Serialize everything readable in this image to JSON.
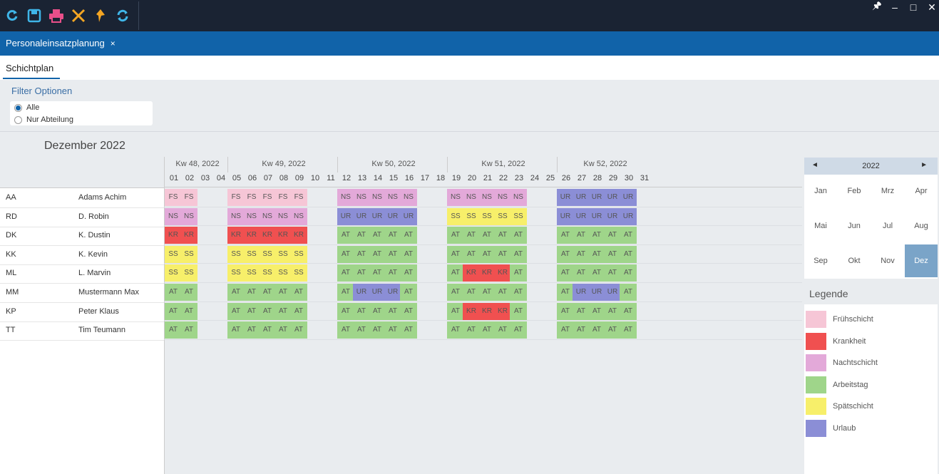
{
  "toolbar": {
    "icons": [
      "refresh-icon",
      "save-icon",
      "print-icon",
      "tools-icon",
      "pin-tool-icon",
      "sync-icon"
    ],
    "colors": {
      "refresh": "#3fb5e8",
      "save": "#3fb5e8",
      "print": "#e94f8a",
      "tools": "#f5a623",
      "pin": "#f5a623",
      "sync": "#3fb5e8"
    }
  },
  "window": {
    "pin": "📌",
    "minimize": "–",
    "maximize": "□",
    "close": "✕"
  },
  "doc_tab": {
    "label": "Personaleinsatzplanung",
    "close": "×"
  },
  "sub_tab": {
    "label": "Schichtplan"
  },
  "filter": {
    "title": "Filter Optionen",
    "options": [
      {
        "label": "Alle",
        "selected": true
      },
      {
        "label": "Nur Abteilung",
        "selected": false
      }
    ]
  },
  "month_title": "Dezember 2022",
  "weeks": [
    {
      "label": "Kw 48, 2022",
      "days": [
        "01",
        "02",
        "03",
        "04"
      ]
    },
    {
      "label": "Kw 49, 2022",
      "days": [
        "05",
        "06",
        "07",
        "08",
        "09",
        "10",
        "11"
      ]
    },
    {
      "label": "Kw 50, 2022",
      "days": [
        "12",
        "13",
        "14",
        "15",
        "16",
        "17",
        "18"
      ]
    },
    {
      "label": "Kw 51, 2022",
      "days": [
        "19",
        "20",
        "21",
        "22",
        "23",
        "24",
        "25"
      ]
    },
    {
      "label": "Kw 52, 2022",
      "days": [
        "26",
        "27",
        "28",
        "29",
        "30",
        "31"
      ]
    }
  ],
  "shift_colors": {
    "FS": "#f6c6d6",
    "KR": "#f05050",
    "NS": "#e3a9d9",
    "AT": "#9fd58a",
    "SS": "#f7ef6a",
    "UR": "#8b8ed6"
  },
  "employees": [
    {
      "abbr": "AA",
      "name": "Adams Achim",
      "shifts": [
        "FS",
        "FS",
        "",
        "",
        "FS",
        "FS",
        "FS",
        "FS",
        "FS",
        "",
        "",
        "NS",
        "NS",
        "NS",
        "NS",
        "NS",
        "",
        "",
        "NS",
        "NS",
        "NS",
        "NS",
        "NS",
        "",
        "",
        "UR",
        "UR",
        "UR",
        "UR",
        "UR",
        ""
      ]
    },
    {
      "abbr": "RD",
      "name": "D. Robin",
      "shifts": [
        "NS",
        "NS",
        "",
        "",
        "NS",
        "NS",
        "NS",
        "NS",
        "NS",
        "",
        "",
        "UR",
        "UR",
        "UR",
        "UR",
        "UR",
        "",
        "",
        "SS",
        "SS",
        "SS",
        "SS",
        "SS",
        "",
        "",
        "UR",
        "UR",
        "UR",
        "UR",
        "UR",
        ""
      ]
    },
    {
      "abbr": "DK",
      "name": "K. Dustin",
      "shifts": [
        "KR",
        "KR",
        "",
        "",
        "KR",
        "KR",
        "KR",
        "KR",
        "KR",
        "",
        "",
        "AT",
        "AT",
        "AT",
        "AT",
        "AT",
        "",
        "",
        "AT",
        "AT",
        "AT",
        "AT",
        "AT",
        "",
        "",
        "AT",
        "AT",
        "AT",
        "AT",
        "AT",
        ""
      ]
    },
    {
      "abbr": "KK",
      "name": "K. Kevin",
      "shifts": [
        "SS",
        "SS",
        "",
        "",
        "SS",
        "SS",
        "SS",
        "SS",
        "SS",
        "",
        "",
        "AT",
        "AT",
        "AT",
        "AT",
        "AT",
        "",
        "",
        "AT",
        "AT",
        "AT",
        "AT",
        "AT",
        "",
        "",
        "AT",
        "AT",
        "AT",
        "AT",
        "AT",
        ""
      ]
    },
    {
      "abbr": "ML",
      "name": "L. Marvin",
      "shifts": [
        "SS",
        "SS",
        "",
        "",
        "SS",
        "SS",
        "SS",
        "SS",
        "SS",
        "",
        "",
        "AT",
        "AT",
        "AT",
        "AT",
        "AT",
        "",
        "",
        "AT",
        "KR",
        "KR",
        "KR",
        "AT",
        "",
        "",
        "AT",
        "AT",
        "AT",
        "AT",
        "AT",
        ""
      ]
    },
    {
      "abbr": "MM",
      "name": "Mustermann Max",
      "shifts": [
        "AT",
        "AT",
        "",
        "",
        "AT",
        "AT",
        "AT",
        "AT",
        "AT",
        "",
        "",
        "AT",
        "UR",
        "UR",
        "UR",
        "AT",
        "",
        "",
        "AT",
        "AT",
        "AT",
        "AT",
        "AT",
        "",
        "",
        "AT",
        "UR",
        "UR",
        "UR",
        "AT",
        ""
      ]
    },
    {
      "abbr": "KP",
      "name": "Peter Klaus",
      "shifts": [
        "AT",
        "AT",
        "",
        "",
        "AT",
        "AT",
        "AT",
        "AT",
        "AT",
        "",
        "",
        "AT",
        "AT",
        "AT",
        "AT",
        "AT",
        "",
        "",
        "AT",
        "KR",
        "KR",
        "KR",
        "AT",
        "",
        "",
        "AT",
        "AT",
        "AT",
        "AT",
        "AT",
        ""
      ]
    },
    {
      "abbr": "TT",
      "name": "Tim Teumann",
      "shifts": [
        "AT",
        "AT",
        "",
        "",
        "AT",
        "AT",
        "AT",
        "AT",
        "AT",
        "",
        "",
        "AT",
        "AT",
        "AT",
        "AT",
        "AT",
        "",
        "",
        "AT",
        "AT",
        "AT",
        "AT",
        "AT",
        "",
        "",
        "AT",
        "AT",
        "AT",
        "AT",
        "AT",
        ""
      ]
    }
  ],
  "calendar": {
    "year": "2022",
    "prev": "◄",
    "next": "►",
    "months": [
      "Jan",
      "Feb",
      "Mrz",
      "Apr",
      "Mai",
      "Jun",
      "Jul",
      "Aug",
      "Sep",
      "Okt",
      "Nov",
      "Dez"
    ],
    "selected": "Dez"
  },
  "legend": {
    "title": "Legende",
    "items": [
      {
        "label": "Frühschicht",
        "color": "#f6c6d6"
      },
      {
        "label": "Krankheit",
        "color": "#f05050"
      },
      {
        "label": "Nachtschicht",
        "color": "#e3a9d9"
      },
      {
        "label": "Arbeitstag",
        "color": "#9fd58a"
      },
      {
        "label": "Spätschicht",
        "color": "#f7ef6a"
      },
      {
        "label": "Urlaub",
        "color": "#8b8ed6"
      }
    ]
  }
}
